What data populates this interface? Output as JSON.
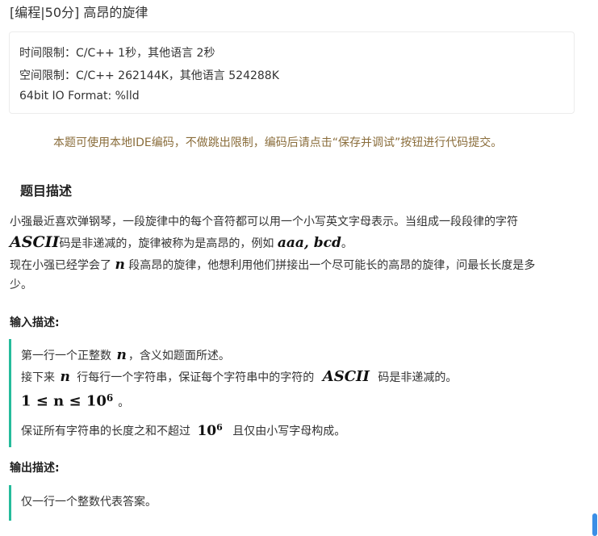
{
  "header": {
    "title": "[编程|50分] 高昂的旋律"
  },
  "limits": {
    "time": "时间限制：C/C++ 1秒，其他语言 2秒",
    "space": "空间限制：C/C++ 262144K，其他语言 524288K",
    "io": "64bit IO Format: %lld"
  },
  "notice": "本题可使用本地IDE编码，不做跳出限制，编码后请点击“保存并调试”按钮进行代码提交。",
  "description": {
    "title": "题目描述",
    "line1": "小强最近喜欢弹钢琴，一段旋律中的每个音符都可以用一个小写英文字母表示。当组成一段段律的字符",
    "ascii": "ASCII",
    "line2_mid": "码是非递减的，旋律被称为是高昂的，例如 ",
    "example": "aaa, bcd",
    "line2_end": "。",
    "line3_pre": "现在小强已经学会了 ",
    "n": "n",
    "line3_post": " 段高昂的旋律，他想利用他们拼接出一个尽可能长的高昂的旋律，问最长长度是多",
    "line4": "少。"
  },
  "input": {
    "title": "输入描述:",
    "l1_pre": "第一行一个正整数 ",
    "n": "n",
    "l1_post": "，含义如题面所述。",
    "l2_pre": "接下来 ",
    "l2_mid": " 行每行一个字符串，保证每个字符串中的字符的 ",
    "ascii": "ASCII",
    "l2_post": " 码是非递减的。",
    "constraint": "1 ≤ n ≤ 10",
    "exp": "6",
    "constraint_end": "。",
    "l4_pre": "保证所有字符串的长度之和不超过 ",
    "ten": "10",
    "l4_post": " 且仅由小写字母构成。"
  },
  "output": {
    "title": "输出描述:",
    "l1": "仅一行一个整数代表答案。"
  },
  "colors": {
    "accent": "#25bb9b",
    "notice": "#8a6d3b",
    "scrollbar": "#3a8ee6"
  }
}
